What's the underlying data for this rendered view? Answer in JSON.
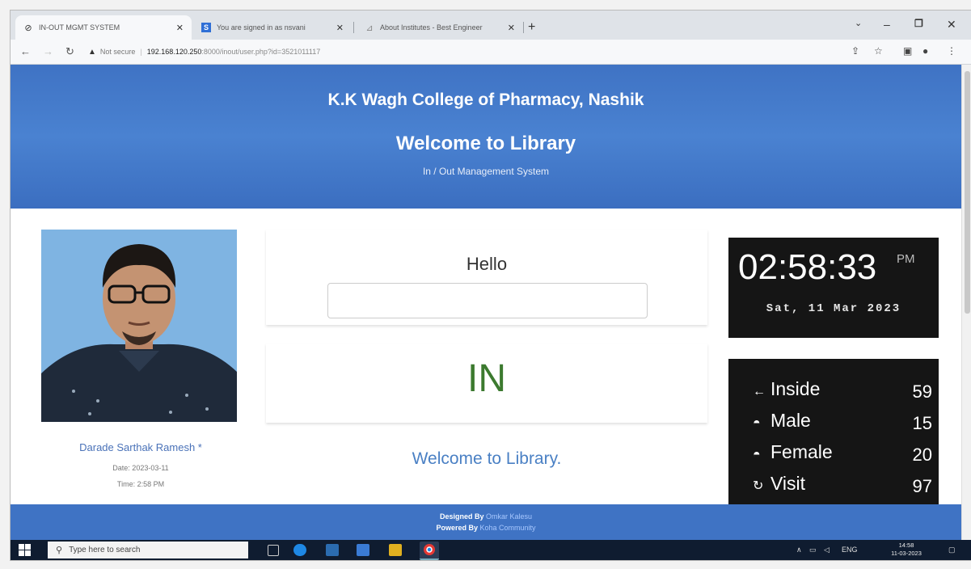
{
  "browser": {
    "tabs": [
      {
        "label": "IN-OUT MGMT SYSTEM",
        "icon": "globe-icon"
      },
      {
        "label": "You are signed in as nsvani",
        "icon": "s-badge-icon"
      },
      {
        "label": "About Institutes - Best Engineer",
        "icon": "site-icon"
      }
    ],
    "new_tab_label": "+",
    "address": {
      "security_label": "Not secure",
      "host": "192.168.120.250",
      "path": ":8000/inout/user.php?id=3521011117"
    }
  },
  "header": {
    "college": "K.K Wagh College of Pharmacy, Nashik",
    "welcome": "Welcome to Library",
    "subtitle": "In / Out Management System"
  },
  "student": {
    "name": "Darade Sarthak Ramesh *",
    "date_label": "Date: 2023-03-11",
    "time_label": "Time: 2:58 PM"
  },
  "greeting": {
    "hello": "Hello",
    "input_value": ""
  },
  "status": {
    "value": "IN",
    "message": "Welcome to Library."
  },
  "clock": {
    "time": "02:58:33",
    "ampm": "PM",
    "date": "Sat, 11 Mar 2023"
  },
  "stats": [
    {
      "icon": "arrow-left-icon",
      "label": "Inside",
      "value": "59"
    },
    {
      "icon": "male-icon",
      "label": "Male",
      "value": "15"
    },
    {
      "icon": "female-icon",
      "label": "Female",
      "value": "20"
    },
    {
      "icon": "refresh-icon",
      "label": "Visit",
      "value": "97"
    }
  ],
  "footer": {
    "designed_prefix": "Designed By",
    "designer": "Omkar Kalesu",
    "powered_prefix": "Powered By",
    "powered": "Koha Community"
  },
  "taskbar": {
    "search_placeholder": "Type here to search",
    "lang": "ENG",
    "time": "14:58",
    "date": "11-03-2023"
  },
  "colors": {
    "banner": "#3f73c4",
    "status_in": "#3c7a2f",
    "link": "#4a80c4",
    "panel_dark": "#151515"
  }
}
